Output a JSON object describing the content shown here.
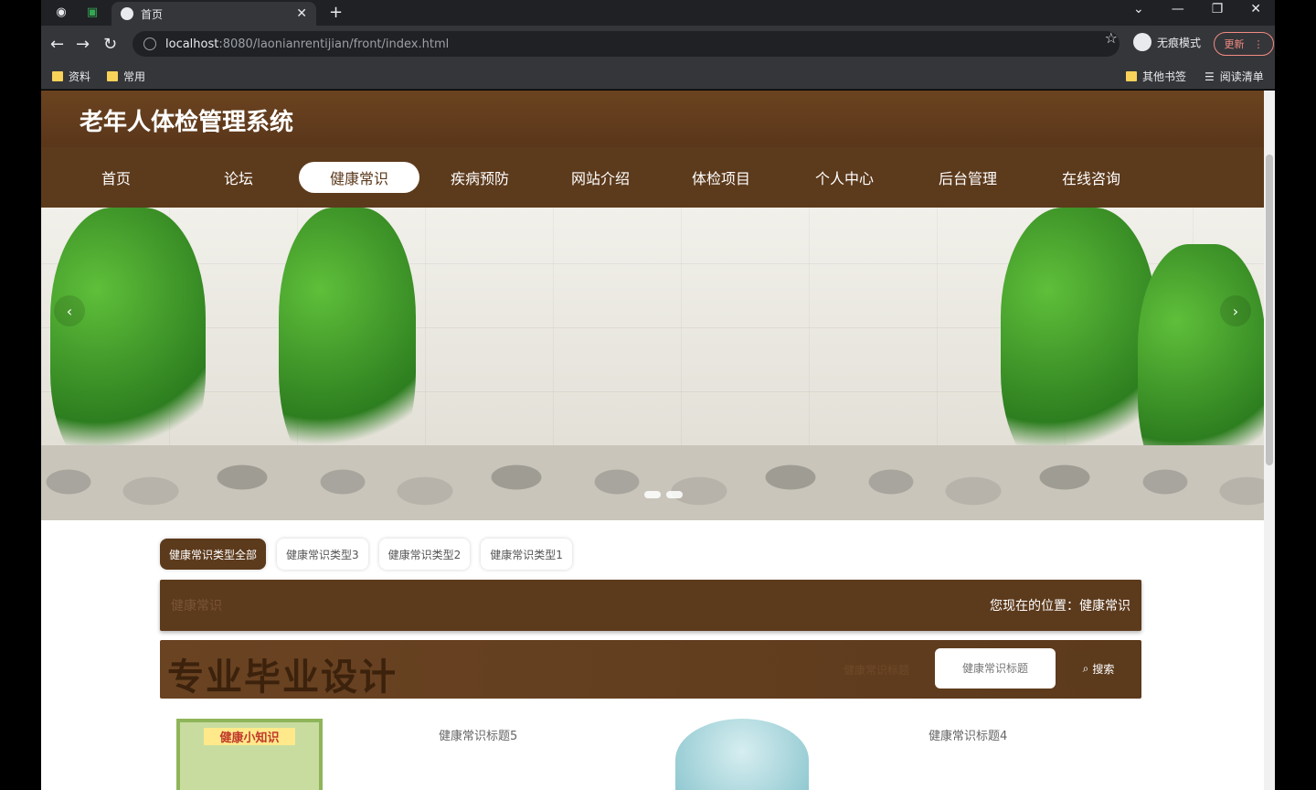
{
  "browser": {
    "tab_title": "首页",
    "url_host": "localhost",
    "url_path": ":8080/laonianrentijian/front/index.html",
    "incognito_label": "无痕模式",
    "update_label": "更新",
    "bookmarks": [
      "资料",
      "常用"
    ],
    "bookmarks_right": [
      "其他书签",
      "阅读清单"
    ]
  },
  "site": {
    "title": "老年人体检管理系统",
    "nav": [
      "首页",
      "论坛",
      "健康常识",
      "疾病预防",
      "网站介绍",
      "体检项目",
      "个人中心",
      "后台管理",
      "在线咨询"
    ],
    "active_nav": "健康常识"
  },
  "filters": [
    "健康常识类型全部",
    "健康常识类型3",
    "健康常识类型2",
    "健康常识类型1"
  ],
  "location": {
    "left": "健康常识",
    "right": "您现在的位置：健康常识"
  },
  "search": {
    "watermark": "专业毕业设计",
    "label": "健康常识标题",
    "placeholder": "健康常识标题",
    "button": "搜索"
  },
  "cards": [
    {
      "image_caption": "健康小知识",
      "title": "健康常识标题5"
    },
    {
      "title": "健康常识标题4"
    }
  ],
  "colors": {
    "brand": "#5c3a1c",
    "header": "#6b4320"
  }
}
